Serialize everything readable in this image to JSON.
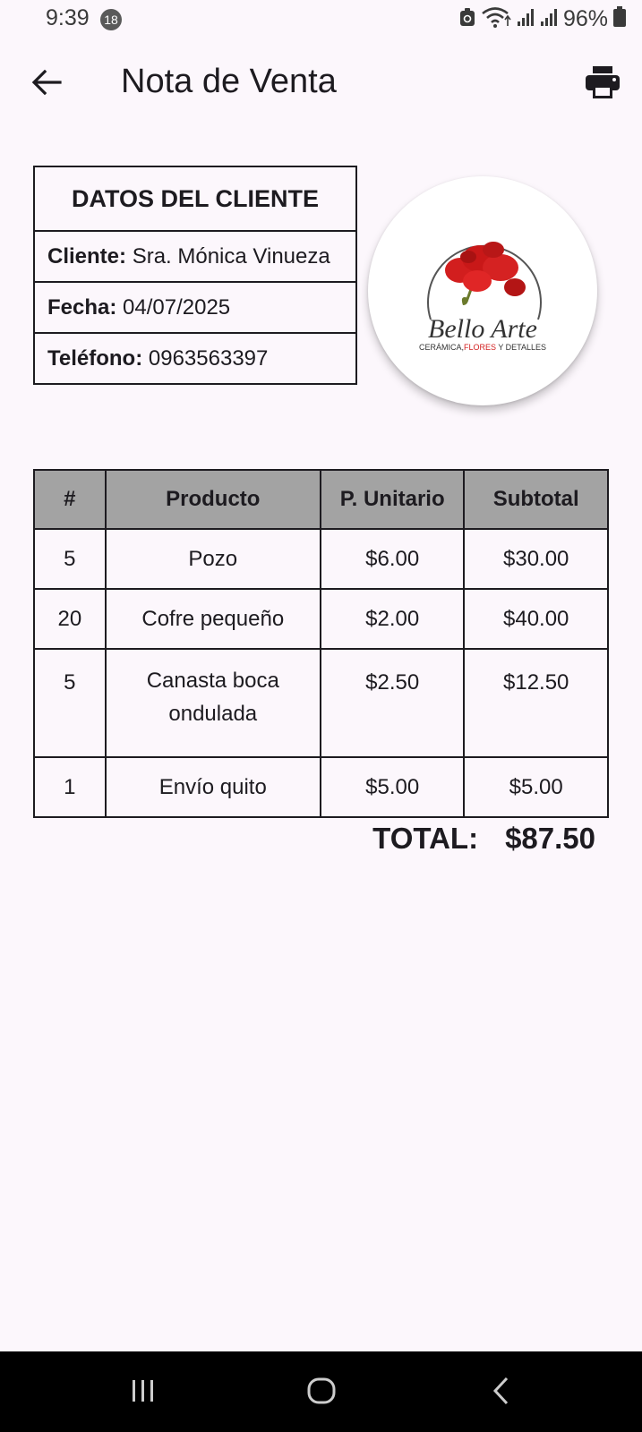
{
  "status_bar": {
    "time": "9:39",
    "notification_count": "18",
    "battery": "96%"
  },
  "app_bar": {
    "title": "Nota de Venta",
    "back_icon": "arrow-left-icon",
    "print_icon": "printer-icon"
  },
  "client": {
    "header": "DATOS DEL CLIENTE",
    "name_label": "Cliente:",
    "name_value": "Sra. Mónica Vinueza",
    "date_label": "Fecha:",
    "date_value": "04/07/2025",
    "phone_label": "Teléfono:",
    "phone_value": "0963563397"
  },
  "logo": {
    "brand": "Bello Arte",
    "tagline_a": "CERÁMICA,",
    "tagline_b": "FLORES",
    "tagline_c": " Y DETALLES"
  },
  "table": {
    "headers": [
      "#",
      "Producto",
      "P. Unitario",
      "Subtotal"
    ],
    "rows": [
      {
        "qty": "5",
        "product": "Pozo",
        "unit": "$6.00",
        "subtotal": "$30.00"
      },
      {
        "qty": "20",
        "product": "Cofre pequeño",
        "unit": "$2.00",
        "subtotal": "$40.00"
      },
      {
        "qty": "5",
        "product": "Canasta boca ondulada",
        "unit": "$2.50",
        "subtotal": "$12.50"
      },
      {
        "qty": "1",
        "product": "Envío quito",
        "unit": "$5.00",
        "subtotal": "$5.00"
      }
    ]
  },
  "total": {
    "label": "TOTAL:",
    "value": "$87.50"
  },
  "nav": {
    "recents_icon": "recents-icon",
    "home_icon": "home-icon",
    "back_icon": "nav-back-icon"
  },
  "colors": {
    "background": "#fcf7fc",
    "table_header": "#a3a3a3",
    "flower_red": "#d21e1e"
  }
}
